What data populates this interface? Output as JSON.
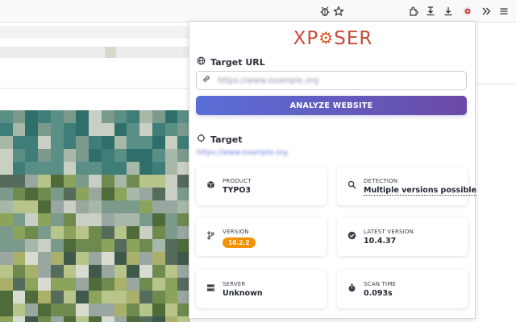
{
  "popup": {
    "logo_left": "XP",
    "logo_gear": "⚙",
    "logo_right": "SER",
    "target_url_section": {
      "title": "Target URL",
      "input_value": "https://www.example.org",
      "analyze_label": "ANALYZE WEBSITE"
    },
    "target_section": {
      "title": "Target",
      "url": "https://www.example.org"
    },
    "cards": {
      "product": {
        "label": "PRODUCT",
        "value": "TYPO3"
      },
      "detection": {
        "label": "DETECTION",
        "value": "Multiple versions possible"
      },
      "version": {
        "label": "VERSION",
        "value": "10.2.2"
      },
      "latest_version": {
        "label": "LATEST VERSION",
        "value": "10.4.37"
      },
      "server": {
        "label": "SERVER",
        "value": "Unknown"
      },
      "scan_time": {
        "label": "SCAN TIME",
        "value": "0.093s"
      }
    },
    "colors": {
      "accent_start": "#5a6fd8",
      "accent_end": "#6b4aa6",
      "version_badge": "#f39200",
      "logo": "#c84a3a"
    }
  },
  "toolbar_icons": [
    "bug-icon",
    "star-icon",
    "extensions-icon",
    "save-icon",
    "download-icon",
    "xposer-extension-icon",
    "overflow-icon",
    "menu-icon"
  ]
}
